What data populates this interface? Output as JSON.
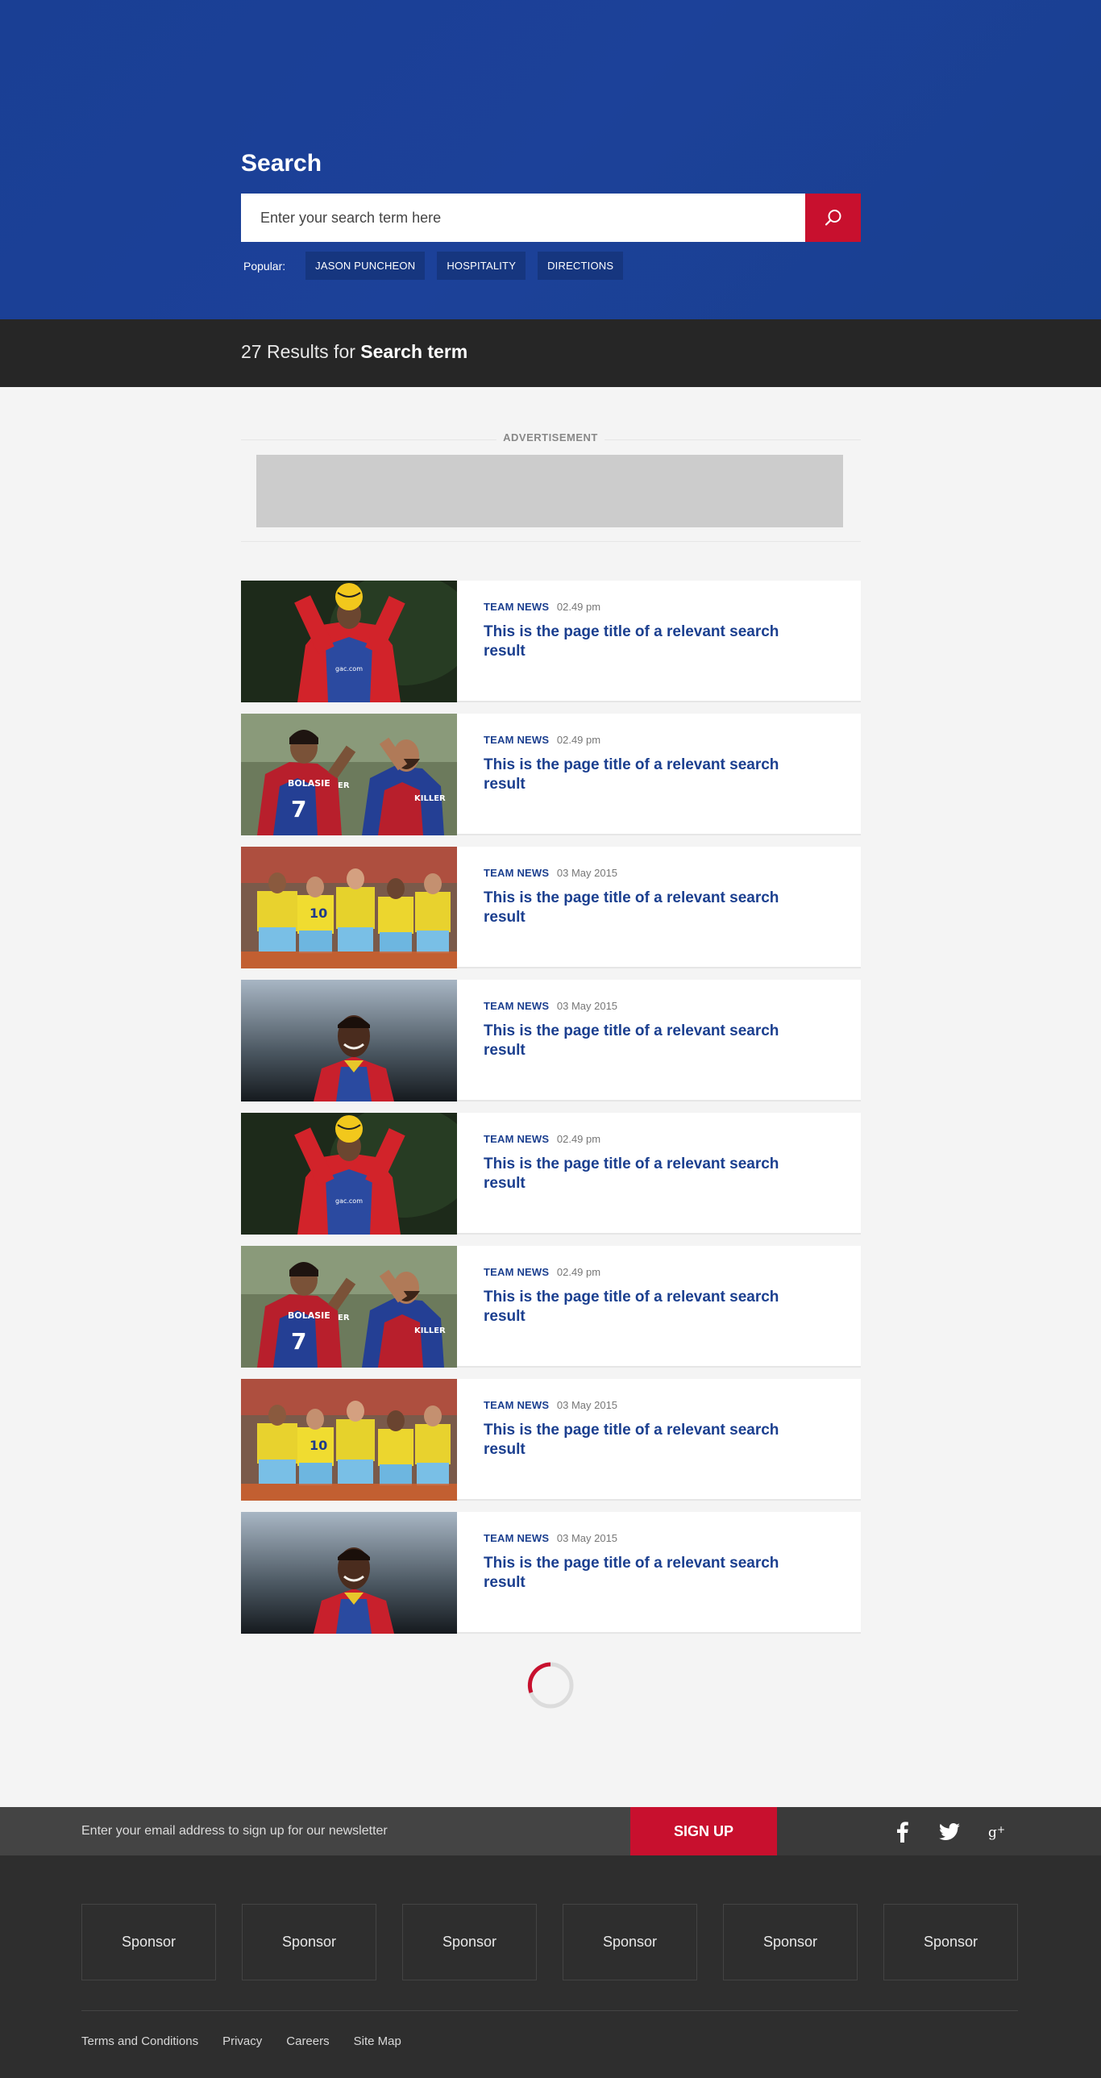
{
  "hero": {
    "title": "Search",
    "search_placeholder": "Enter your search term here",
    "popular_label": "Popular:",
    "popular_tags": [
      "JASON PUNCHEON",
      "HOSPITALITY",
      "DIRECTIONS"
    ]
  },
  "results_bar": {
    "count_text": "27 Results for",
    "term": "Search term"
  },
  "advertisement": {
    "label": "ADVERTISEMENT"
  },
  "results": [
    {
      "category": "TEAM NEWS",
      "date": "02.49 pm",
      "title": "This is the page title of a relevant search result",
      "image": "player-holding-ball-overhead"
    },
    {
      "category": "TEAM NEWS",
      "date": "02.49 pm",
      "title": "This is the page title of a relevant search result",
      "image": "players-high-five"
    },
    {
      "category": "TEAM NEWS",
      "date": "03 May 2015",
      "title": "This is the page title of a relevant search result",
      "image": "team-huddle-yellow-kit"
    },
    {
      "category": "TEAM NEWS",
      "date": "03 May 2015",
      "title": "This is the page title of a relevant search result",
      "image": "player-smiling-portrait"
    },
    {
      "category": "TEAM NEWS",
      "date": "02.49 pm",
      "title": "This is the page title of a relevant search result",
      "image": "player-holding-ball-overhead"
    },
    {
      "category": "TEAM NEWS",
      "date": "02.49 pm",
      "title": "This is the page title of a relevant search result",
      "image": "players-high-five"
    },
    {
      "category": "TEAM NEWS",
      "date": "03 May 2015",
      "title": "This is the page title of a relevant search result",
      "image": "team-huddle-yellow-kit"
    },
    {
      "category": "TEAM NEWS",
      "date": "03 May 2015",
      "title": "This is the page title of a relevant search result",
      "image": "player-smiling-portrait"
    }
  ],
  "newsletter": {
    "placeholder": "Enter your email address to sign up for our newsletter",
    "button_label": "SIGN UP"
  },
  "social_icons": [
    "facebook-icon",
    "twitter-icon",
    "google-plus-icon"
  ],
  "sponsors": [
    "Sponsor",
    "Sponsor",
    "Sponsor",
    "Sponsor",
    "Sponsor",
    "Sponsor"
  ],
  "footer_links": [
    "Terms and Conditions",
    "Privacy",
    "Careers",
    "Site Map"
  ],
  "colors": {
    "brand_blue": "#1c4199",
    "brand_red": "#c8102e",
    "dark_bar": "#262626",
    "footer_bg": "#2e2e2e",
    "link_blue": "#1b3f8f"
  }
}
